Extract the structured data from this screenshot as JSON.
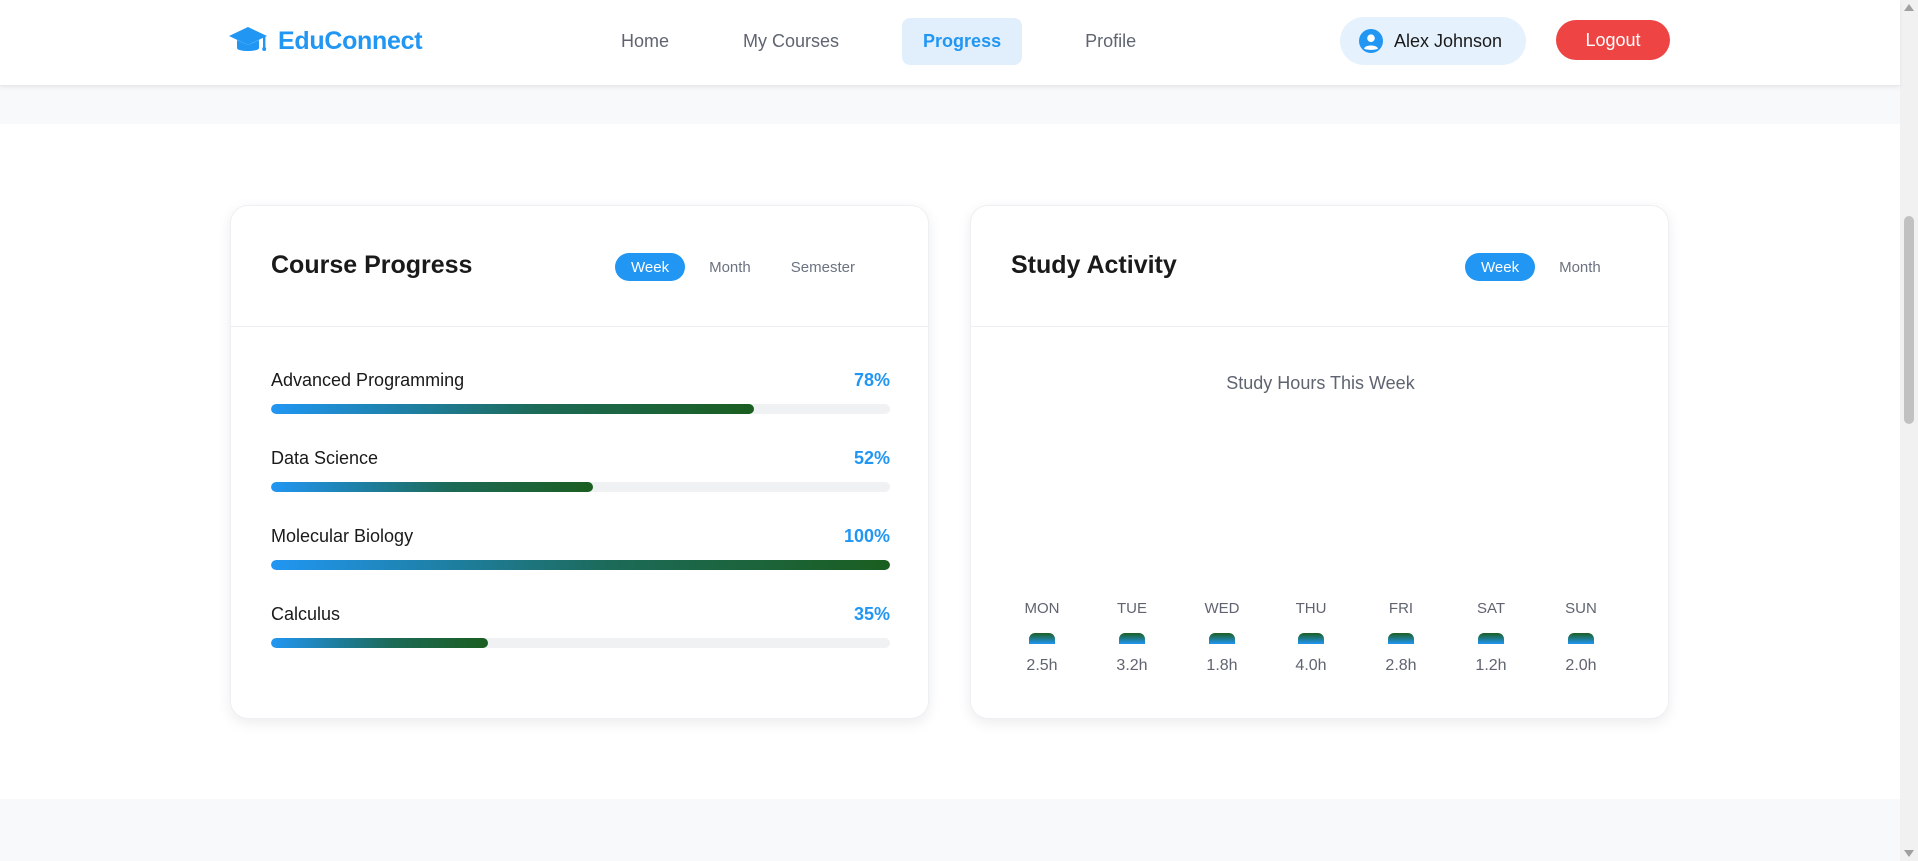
{
  "header": {
    "brand": "EduConnect",
    "brand_icon": "graduation-cap-icon",
    "nav": [
      {
        "label": "Home",
        "active": false
      },
      {
        "label": "My Courses",
        "active": false
      },
      {
        "label": "Progress",
        "active": true
      },
      {
        "label": "Profile",
        "active": false
      }
    ],
    "user_name": "Alex Johnson",
    "user_icon": "user-circle-icon",
    "logout_label": "Logout"
  },
  "course_progress": {
    "title": "Course Progress",
    "periods": [
      {
        "label": "Week",
        "active": true
      },
      {
        "label": "Month",
        "active": false
      },
      {
        "label": "Semester",
        "active": false
      }
    ],
    "courses": [
      {
        "name": "Advanced Programming",
        "percent_label": "78%",
        "percent": 78
      },
      {
        "name": "Data Science",
        "percent_label": "52%",
        "percent": 52
      },
      {
        "name": "Molecular Biology",
        "percent_label": "100%",
        "percent": 100
      },
      {
        "name": "Calculus",
        "percent_label": "35%",
        "percent": 35
      }
    ]
  },
  "study_activity": {
    "title": "Study Activity",
    "periods": [
      {
        "label": "Week",
        "active": true
      },
      {
        "label": "Month",
        "active": false
      }
    ],
    "chart_title": "Study Hours This Week",
    "days": [
      {
        "day": "MON",
        "hours": 2.5,
        "label": "2.5h"
      },
      {
        "day": "TUE",
        "hours": 3.2,
        "label": "3.2h"
      },
      {
        "day": "WED",
        "hours": 1.8,
        "label": "1.8h"
      },
      {
        "day": "THU",
        "hours": 4.0,
        "label": "4.0h"
      },
      {
        "day": "FRI",
        "hours": 2.8,
        "label": "2.8h"
      },
      {
        "day": "SAT",
        "hours": 1.2,
        "label": "1.2h"
      },
      {
        "day": "SUN",
        "hours": 2.0,
        "label": "2.0h"
      }
    ]
  },
  "colors": {
    "accent": "#2196f3",
    "logout": "#ef4444",
    "progress_start": "#2196f3",
    "progress_end": "#1b5e20"
  }
}
